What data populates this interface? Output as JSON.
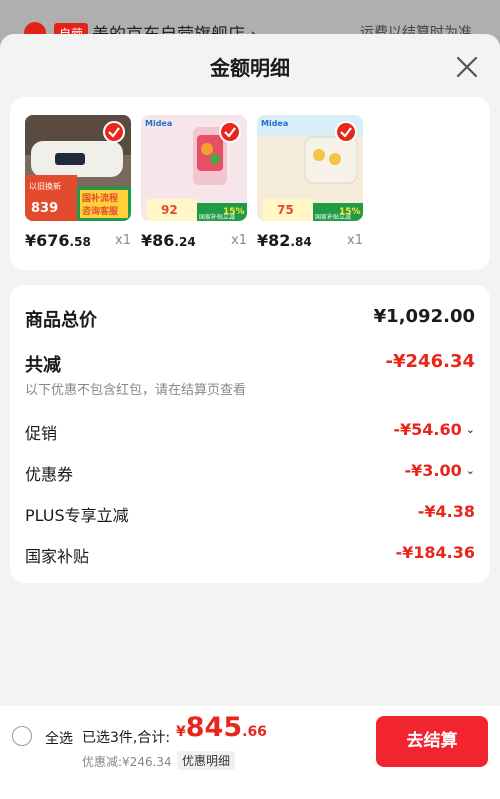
{
  "background": {
    "badge": "自营",
    "store_name": "美的京东自营旗舰店",
    "chevron": "›",
    "shipping_note": "运费以结算时为准"
  },
  "sheet": {
    "title": "金额明细"
  },
  "products": [
    {
      "price_int": "¥676",
      "price_dec": ".58",
      "qty": "x1",
      "image_texts": [
        "国补流程",
        "咨询客服",
        "839",
        "以旧换新"
      ]
    },
    {
      "price_int": "¥86",
      "price_dec": ".24",
      "qty": "x1",
      "image_texts": [
        "Midea",
        "92",
        "15%",
        "国家补贴立减"
      ]
    },
    {
      "price_int": "¥82",
      "price_dec": ".84",
      "qty": "x1",
      "image_texts": [
        "Midea",
        "75",
        "15%",
        "国家补贴立减"
      ]
    }
  ],
  "summary": {
    "total_label": "商品总价",
    "total_value": "¥1,092.00",
    "reduce_label": "共减",
    "reduce_value": "-¥246.34",
    "reduce_note": "以下优惠不包含红包，请在结算页查看",
    "items": [
      {
        "label": "促销",
        "value": "-¥54.60",
        "expandable": true
      },
      {
        "label": "优惠券",
        "value": "-¥3.00",
        "expandable": true
      },
      {
        "label": "PLUS专享立减",
        "value": "-¥4.38",
        "expandable": false
      },
      {
        "label": "国家补贴",
        "value": "-¥184.36",
        "expandable": false
      }
    ]
  },
  "bottom_bar": {
    "select_all": "全选",
    "selected_text": "已选3件,合计:",
    "sum_currency": "¥",
    "sum_int": "845",
    "sum_dec": ".66",
    "discount_note": "优惠减:¥246.34",
    "detail_link": "优惠明细",
    "checkout": "去结算"
  },
  "colors": {
    "accent_red": "#e8261c",
    "checkout_red": "#f2242f",
    "page_bg": "#f3f3f3"
  }
}
